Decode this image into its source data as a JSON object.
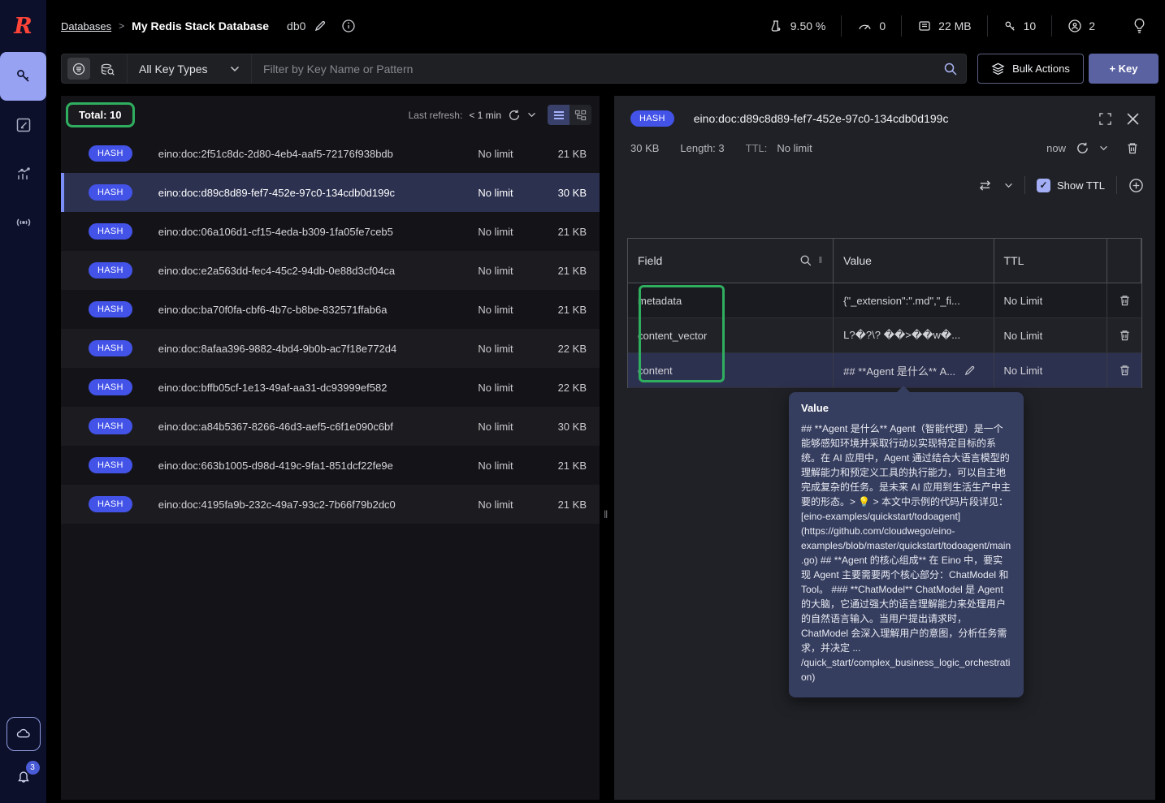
{
  "sidebar": {
    "notifications_badge": "3"
  },
  "header": {
    "breadcrumb_root": "Databases",
    "breadcrumb_sep": ">",
    "breadcrumb_current": "My Redis Stack Database",
    "db_label": "db0",
    "stats": {
      "cpu": "9.50 %",
      "commands_per_sec": "0",
      "memory": "22 MB",
      "total_keys": "10",
      "connected_clients": "2"
    }
  },
  "filterbar": {
    "key_type_selector": "All Key Types",
    "search_placeholder": "Filter by Key Name or Pattern",
    "bulk_actions_label": "Bulk Actions",
    "add_key_label": "+ Key"
  },
  "keylist": {
    "total_label": "Total: 10",
    "last_refresh_label": "Last refresh:",
    "last_refresh_value": "< 1 min",
    "rows": [
      {
        "type": "HASH",
        "name": "eino:doc:2f51c8dc-2d80-4eb4-aaf5-72176f938bdb",
        "ttl": "No limit",
        "size": "21 KB"
      },
      {
        "type": "HASH",
        "name": "eino:doc:d89c8d89-fef7-452e-97c0-134cdb0d199c",
        "ttl": "No limit",
        "size": "30 KB",
        "selected": true
      },
      {
        "type": "HASH",
        "name": "eino:doc:06a106d1-cf15-4eda-b309-1fa05fe7ceb5",
        "ttl": "No limit",
        "size": "21 KB"
      },
      {
        "type": "HASH",
        "name": "eino:doc:e2a563dd-fec4-45c2-94db-0e88d3cf04ca",
        "ttl": "No limit",
        "size": "21 KB"
      },
      {
        "type": "HASH",
        "name": "eino:doc:ba70f0fa-cbf6-4b7c-b8be-832571ffab6a",
        "ttl": "No limit",
        "size": "21 KB"
      },
      {
        "type": "HASH",
        "name": "eino:doc:8afaa396-9882-4bd4-9b0b-ac7f18e772d4",
        "ttl": "No limit",
        "size": "22 KB"
      },
      {
        "type": "HASH",
        "name": "eino:doc:bffb05cf-1e13-49af-aa31-dc93999ef582",
        "ttl": "No limit",
        "size": "22 KB"
      },
      {
        "type": "HASH",
        "name": "eino:doc:a84b5367-8266-46d3-aef5-c6f1e090c6bf",
        "ttl": "No limit",
        "size": "30 KB"
      },
      {
        "type": "HASH",
        "name": "eino:doc:663b1005-d98d-419c-9fa1-851dcf22fe9e",
        "ttl": "No limit",
        "size": "21 KB"
      },
      {
        "type": "HASH",
        "name": "eino:doc:4195fa9b-232c-49a7-93c2-7b66f79b2dc0",
        "ttl": "No limit",
        "size": "21 KB"
      }
    ]
  },
  "detail": {
    "type_badge": "HASH",
    "key_name": "eino:doc:d89c8d89-fef7-452e-97c0-134cdb0d199c",
    "size": "30 KB",
    "length_label": "Length: 3",
    "ttl_label": "TTL:",
    "ttl_value": "No limit",
    "refreshed_label": "now",
    "show_ttl_label": "Show TTL",
    "table": {
      "header_field": "Field",
      "header_value": "Value",
      "header_ttl": "TTL",
      "rows": [
        {
          "field": "metadata",
          "value": "{\"_extension\":\".md\",\"_fi...",
          "ttl": "No Limit"
        },
        {
          "field": "content_vector",
          "value": "L?�?\\? ��>��w�...",
          "ttl": "No Limit"
        },
        {
          "field": "content",
          "value": "## **Agent 是什么** A...",
          "ttl": "No Limit",
          "selected": true,
          "editable": true
        }
      ]
    }
  },
  "tooltip": {
    "title": "Value",
    "text": "## **Agent 是什么** Agent（智能代理）是一个能够感知环境并采取行动以实现特定目标的系统。在 AI 应用中，Agent 通过结合大语言模型的理解能力和预定义工具的执行能力，可以自主地完成复杂的任务。是未来 AI 应用到生活生产中主要的形态。> 💡 > 本文中示例的代码片段详见：[eino-examples/quickstart/todoagent](https://github.com/cloudwego/eino-examples/blob/master/quickstart/todoagent/main.go) ## **Agent 的核心组成** 在 Eino 中，要实现 Agent 主要需要两个核心部分：ChatModel 和 Tool。 ### **ChatModel** ChatModel 是 Agent 的大脑，它通过强大的语言理解能力来处理用户的自然语言输入。当用户提出请求时，ChatModel 会深入理解用户的意图，分析任务需求，并决定 ... /quick_start/complex_business_logic_orchestration)"
  },
  "colors": {
    "accent_blue": "#4353e8",
    "annotation_green": "#2fae5f",
    "selected_row": "#2c3150",
    "sidebar_bg": "#0c102b",
    "nav_selected": "#97a2f3",
    "tooltip_bg": "#363e5f",
    "add_key_button": "#5a62a2"
  }
}
